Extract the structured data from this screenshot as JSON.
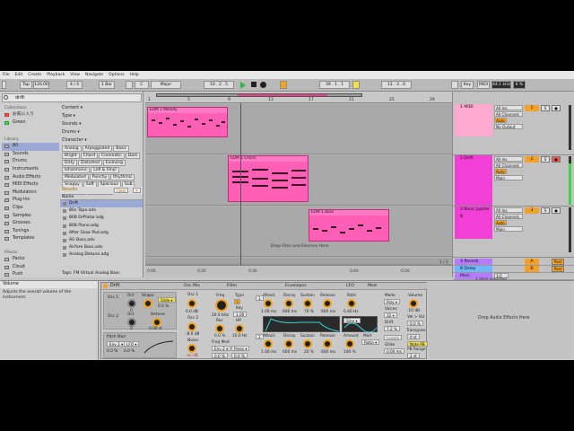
{
  "menu": [
    "File",
    "Edit",
    "Create",
    "Playback",
    "View",
    "Navigate",
    "Options",
    "Help"
  ],
  "transport": {
    "tap": "Tap",
    "tempo": "120.00",
    "meter": "4 / 4",
    "quant": "1 Bar",
    "key": "C",
    "scale": "Major",
    "position": "10 .  2 .  5",
    "loop_start": "39 .  1 .  1",
    "loop_len": "12 .  3 .  0",
    "key_btn": "Key",
    "midi_btn": "MIDI",
    "sample_rate": "44.1 kHz",
    "cpu": "6 %"
  },
  "browser": {
    "search_value": "drift",
    "collections_head": "Collections",
    "collections": [
      "お気に入り",
      "Green"
    ],
    "library_head": "Library",
    "library": [
      "All",
      "Sounds",
      "Drums",
      "Instruments",
      "Audio Effects",
      "MIDI Effects",
      "Modulators",
      "Plug-Ins",
      "Clips",
      "Samples",
      "Grooves",
      "Tunings",
      "Templates"
    ],
    "places_head": "Places",
    "places": [
      "Packs",
      "Cloud",
      "Push"
    ],
    "filters": [
      "Content ▾",
      "Type ▾",
      "Sounds ▾",
      "Drums ▾",
      "Character ▾"
    ],
    "tags": [
      "Analog",
      "Arpeggiated",
      "Basic",
      "Bright",
      "Chord",
      "Cinematic",
      "Dark",
      "Dirty",
      "Distorted",
      "Evolving",
      "Inharmonic",
      "Lofi & Vinyl",
      "Modulated",
      "Punchy",
      "Rhythmic",
      "Snappy",
      "Soft",
      "Spacious",
      "Sub",
      "Synthetic",
      "Sustained"
    ],
    "results_label": "Results",
    "clear": "Clear",
    "col_name": "Name",
    "results": [
      "Drift",
      "80s Tape.adv",
      "808 DrPlatar.adg",
      "808 Piano.adg",
      "After Glow Pad.adg",
      "AG Bass.adv",
      "Airfare Bass.adv",
      "Analog Detune.adg"
    ],
    "tags_bar": "Tags:  FM    Virtual Analog    Bass"
  },
  "arrangement": {
    "ruler": [
      "1",
      "5",
      "9",
      "13",
      "17",
      "21",
      "25",
      "29"
    ],
    "clips": [
      {
        "title": "EDM 1 Melody"
      },
      {
        "title": "EDM 1 Chord"
      },
      {
        "title": "EDM 1 Bass"
      }
    ],
    "drop_text": "Drop Files and Devices Here",
    "time_marks": [
      "0:00",
      "0:20",
      "0:30",
      "0:40",
      "0:50"
    ],
    "page": "1 / 3"
  },
  "mixer": {
    "tracks": [
      {
        "name": "1 MIDI",
        "input": "All Ins",
        "channel": "All Channels",
        "mon": "Auto",
        "out": "No Output",
        "num": "1",
        "color": "#ffa8d0"
      },
      {
        "name": "2 Drift",
        "input": "All Ins",
        "channel": "All Channels",
        "mon": "Auto",
        "out": "Main",
        "num": "2",
        "color": "#f23fd5"
      },
      {
        "name": "3 Basic Jupiter B",
        "input": "All Ins",
        "channel": "All Channels",
        "mon": "Auto",
        "out": "Main",
        "num": "3",
        "color": "#f23fd5"
      }
    ],
    "returns": [
      {
        "name": "A Reverb",
        "letter": "A",
        "color": "#b67cff"
      },
      {
        "name": "B Delay",
        "letter": "B",
        "color": "#6fb7ff"
      },
      {
        "name": "Main",
        "letter": "1/2",
        "color": "#b67cff"
      }
    ],
    "post": "Post"
  },
  "info": {
    "title": "Volume",
    "text": "Adjusts the overall volume of the instrument.",
    "status": "1 item selected"
  },
  "device": {
    "name": "Drift",
    "sections": {
      "osc_mix": "Osc Mix",
      "filter": "Filter",
      "envelopes": "Envelopes",
      "lfo": "LFO",
      "mod": "Mod"
    },
    "osc1": {
      "label": "Osc 1",
      "oct": "Oct",
      "shape": "Shape",
      "oct_val": "0",
      "wave": "Slide ▾",
      "shape_val": "0.0 %"
    },
    "osc2": {
      "label": "Osc 2",
      "oct": "Oct",
      "detune": "Detune",
      "oct_val": "0",
      "detune_val": "0.00 st"
    },
    "osc1_mix": {
      "label": "Osc 1",
      "val": "0.0 dB"
    },
    "osc2_mix": {
      "label": "Osc 2",
      "val": "-8.0 dB"
    },
    "noise": {
      "label": "Noise",
      "val": "-ini dB"
    },
    "pitch_mod": {
      "label": "Pitch Mod",
      "src1": "Env 2 ▾",
      "src2": "LFO ▾",
      "v1": "0.0 %",
      "v2": "0.0 %"
    },
    "filter": {
      "freq": "Freq",
      "type": "Type",
      "freq_val": "20.0 kHz",
      "key": "Key",
      "key_val": "1.00",
      "res": "Res",
      "hp": "HP",
      "res_val": "0.0 %",
      "hp_val": "10.0 Hz",
      "mod_label": "Freq Mod",
      "mod_src": "Env 2 ▾",
      "mod_src2": "Press ▾",
      "mod_v1": "0.0 %",
      "mod_v2": "0.0 %"
    },
    "env1": {
      "num": "1",
      "attack": "Attack",
      "decay": "Decay",
      "sustain": "Sustain",
      "release": "Release",
      "a": "1.00 ms",
      "d": "600 ms",
      "s": "70 %",
      "r": "600 ms"
    },
    "env2": {
      "num": "2",
      "attack": "Attack",
      "decay": "Decay",
      "sustain": "Sustain",
      "release": "Release",
      "a": "1.00 ms",
      "d": "600 ms",
      "s": "20 %",
      "r": "600 ms"
    },
    "lfo": {
      "rate": "Rate",
      "rate_val": "0.40 Hz",
      "wave": "Sine ▾",
      "amount": "Amount",
      "amount_val": "100 %",
      "mod": "Mod",
      "mod_val": "Ratio ▾"
    },
    "mode": {
      "label": "Mode",
      "val": "Poly ▾",
      "voices": "Voices",
      "voices_val": "32 ▾",
      "drift": "Drift",
      "drift_val": "7.2 %",
      "legato": "Legato",
      "glide": "Glide",
      "glide_val": "0.00 ms"
    },
    "volume": {
      "label": "Volume",
      "val": "-10 dB",
      "vel": "Vel > Vol",
      "vel_val": "0.0 %",
      "transpose": "Transpose",
      "tr_val": "0 st",
      "note_pb": "Note PB",
      "pb": "PB Range",
      "pb_val": "2 st"
    }
  },
  "drop_fx": "Drop Audio Effects Here"
}
